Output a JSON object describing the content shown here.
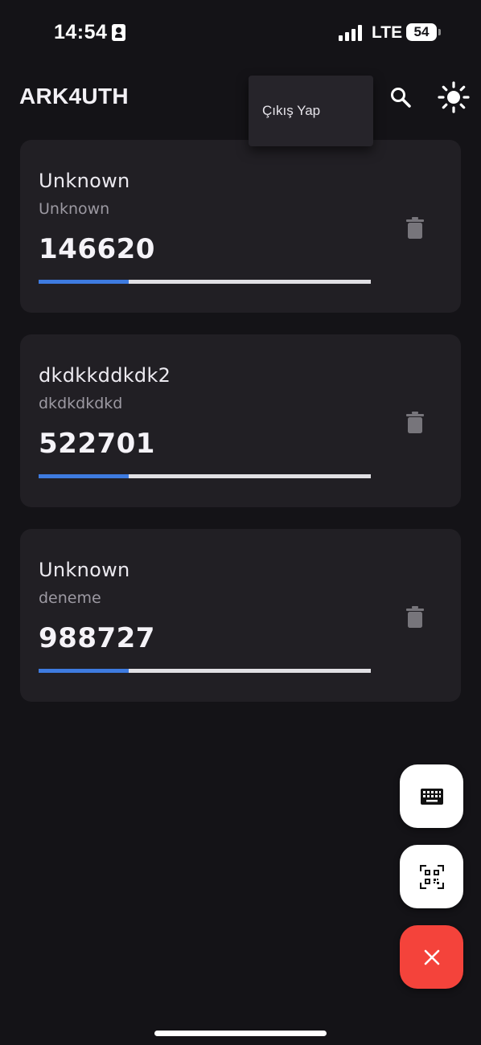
{
  "status_bar": {
    "time": "14:54",
    "network": "LTE",
    "battery": "54"
  },
  "app_bar": {
    "title": "ARK4UTH",
    "search_icon": "search-icon",
    "theme_icon": "sun-icon"
  },
  "menu": {
    "items": [
      {
        "label": "Çıkış Yap"
      }
    ]
  },
  "accounts": [
    {
      "name": "Unknown",
      "issuer": "Unknown",
      "code": "146620",
      "progress": 0.27
    },
    {
      "name": "dkdkkddkdk2",
      "issuer": "dkdkdkdkd",
      "code": "522701",
      "progress": 0.27
    },
    {
      "name": "Unknown",
      "issuer": "deneme",
      "code": "988727",
      "progress": 0.27
    }
  ],
  "fabs": {
    "keyboard_icon": "keyboard-icon",
    "qr_icon": "qr-scan-icon",
    "close_icon": "close-icon"
  },
  "colors": {
    "background": "#141317",
    "card": "#211F24",
    "progress": "#3E7BE0",
    "progress_track": "#E1E0E4",
    "close_fab": "#F4433B"
  }
}
